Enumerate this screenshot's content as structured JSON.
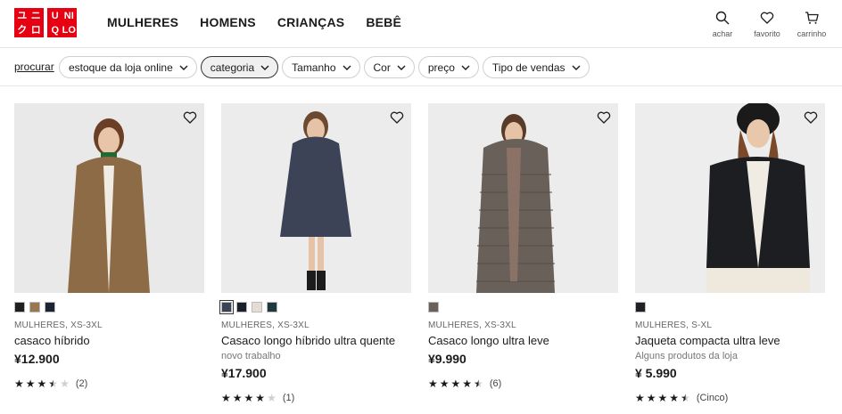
{
  "brand": {
    "logo_left": [
      "ユ",
      "ニ",
      "ク",
      "ロ"
    ],
    "logo_right": [
      "U",
      "NI",
      "Q",
      "LO"
    ]
  },
  "nav": [
    {
      "label": "MULHERES"
    },
    {
      "label": "HOMENS"
    },
    {
      "label": "CRIANÇAS"
    },
    {
      "label": "BEBÊ"
    }
  ],
  "utils": [
    {
      "label": "achar",
      "icon": "search-icon"
    },
    {
      "label": "favorito",
      "icon": "heart-icon"
    },
    {
      "label": "carrinho",
      "icon": "cart-icon"
    }
  ],
  "filters": {
    "search_label": "procurar",
    "chips": [
      {
        "label": "estoque da loja online",
        "active": false
      },
      {
        "label": "categoria",
        "active": true
      },
      {
        "label": "Tamanho",
        "active": false
      },
      {
        "label": "Cor",
        "active": false
      },
      {
        "label": "preço",
        "active": false
      },
      {
        "label": "Tipo de vendas",
        "active": false
      }
    ]
  },
  "products": [
    {
      "swatches": [
        "#1f1f1f",
        "#9b7652",
        "#1c2331"
      ],
      "selected_swatch": -1,
      "meta": "MULHERES, XS-3XL",
      "name": "casaco híbrido",
      "sub": "",
      "price": "¥12.900",
      "rating": 3.5,
      "reviews": "(2)",
      "photo_bg": "#e9e9e9",
      "coat": "#8d6b47"
    },
    {
      "swatches": [
        "#3b4456",
        "#1b1f2a",
        "#e5ddd3",
        "#1e3a3e"
      ],
      "selected_swatch": 0,
      "meta": "MULHERES, XS-3XL",
      "name": "Casaco longo híbrido ultra quente",
      "sub": "novo trabalho",
      "price": "¥17.900",
      "rating": 4,
      "reviews": "(1)",
      "photo_bg": "#ececec",
      "coat": "#3d4356"
    },
    {
      "swatches": [
        "#6b615c"
      ],
      "selected_swatch": -1,
      "meta": "MULHERES, XS-3XL",
      "name": "Casaco longo ultra leve",
      "sub": "",
      "price": "¥9.990",
      "rating": 4.5,
      "reviews": "(6)",
      "photo_bg": "#ececec",
      "coat": "#6a605a"
    },
    {
      "swatches": [
        "#202124"
      ],
      "selected_swatch": -1,
      "meta": "MULHERES, S-XL",
      "name": "Jaqueta compacta ultra leve",
      "sub": "Alguns produtos da loja",
      "price": "¥ 5.990",
      "rating": 4.5,
      "reviews": "(Cinco)",
      "photo_bg": "#ededed",
      "coat": "#1d1e22"
    }
  ]
}
